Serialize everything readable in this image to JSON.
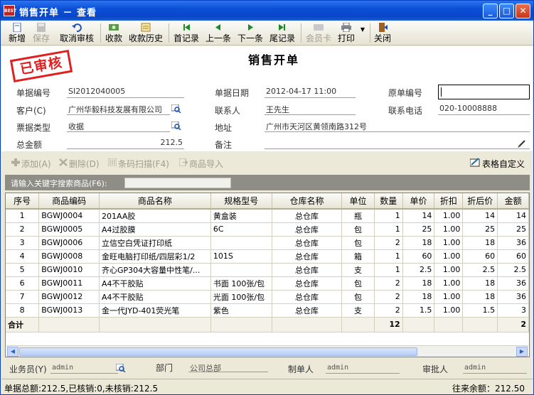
{
  "window": {
    "title": "销售开单 － 查看",
    "logo": "BEST"
  },
  "toolbar": {
    "items": [
      {
        "label": "新增",
        "icon": "new-doc-icon",
        "enabled": true
      },
      {
        "label": "保存",
        "icon": "save-icon",
        "enabled": false
      },
      {
        "label": "取消审核",
        "icon": "undo-icon",
        "enabled": true
      },
      {
        "label": "收款",
        "icon": "money-icon",
        "enabled": true
      },
      {
        "label": "收款历史",
        "icon": "history-icon",
        "enabled": true
      },
      {
        "label": "首记录",
        "icon": "first-record-icon",
        "enabled": true
      },
      {
        "label": "上一条",
        "icon": "prev-record-icon",
        "enabled": true
      },
      {
        "label": "下一条",
        "icon": "next-record-icon",
        "enabled": true
      },
      {
        "label": "尾记录",
        "icon": "last-record-icon",
        "enabled": true
      },
      {
        "label": "会员卡",
        "icon": "member-card-icon",
        "enabled": false
      },
      {
        "label": "打印",
        "icon": "print-icon",
        "enabled": true
      },
      {
        "label": "关闭",
        "icon": "close-door-icon",
        "enabled": true
      }
    ]
  },
  "form": {
    "stamp": "已审核",
    "title": "销售开单",
    "doc_no_label": "单据编号",
    "doc_no": "SI2012040005",
    "doc_date_label": "单据日期",
    "doc_date": "2012-04-17 11:00",
    "orig_no_label": "原单编号",
    "orig_no": "",
    "customer_label": "客户(C)",
    "customer": "广州华毅科技发展有限公司",
    "contact_label": "联系人",
    "contact": "王先生",
    "phone_label": "联系电话",
    "phone": "020-10008888",
    "type_label": "票据类型",
    "type": "收据",
    "address_label": "地址",
    "address": "广州市天河区黄领南路312号",
    "total_label": "总金额",
    "total": "212.5",
    "remark_label": "备注",
    "remark": ""
  },
  "actions": {
    "add": "添加(A)",
    "delete": "删除(D)",
    "scan": "条码扫描(F4)",
    "import": "商品导入",
    "custom": "表格自定义"
  },
  "search": {
    "label": "请输入关键字搜索商品(F6):",
    "value": ""
  },
  "table": {
    "headers": [
      "序号",
      "商品编码",
      "商品名称",
      "规格型号",
      "仓库名称",
      "单位",
      "数量",
      "单价",
      "折扣",
      "折后价",
      "金额"
    ],
    "rows": [
      [
        "1",
        "BGWJ0004",
        "201AA胶",
        "黄盒装",
        "总仓库",
        "瓶",
        "1",
        "14",
        "1.00",
        "14",
        "14"
      ],
      [
        "2",
        "BGWJ0005",
        "A4过胶膜",
        "6C",
        "总仓库",
        "包",
        "1",
        "25",
        "1.00",
        "25",
        "25"
      ],
      [
        "3",
        "BGWJ0006",
        "立信空白凭证打印纸",
        "",
        "总仓库",
        "包",
        "2",
        "18",
        "1.00",
        "18",
        "36"
      ],
      [
        "4",
        "BGWJ0008",
        "金旺电脑打印纸/四层彩1/2",
        "101S",
        "总仓库",
        "箱",
        "1",
        "60",
        "1.00",
        "60",
        "60"
      ],
      [
        "5",
        "BGWJ0010",
        "齐心GP304大容量中性笔/...",
        "",
        "总仓库",
        "支",
        "1",
        "2.5",
        "1.00",
        "2.5",
        "2.5"
      ],
      [
        "6",
        "BGWJ0011",
        "A4不干胶贴",
        "书面 100张/包",
        "总仓库",
        "包",
        "2",
        "18",
        "1.00",
        "18",
        "36"
      ],
      [
        "7",
        "BGWJ0012",
        "A4不干胶贴",
        "光面 100张/包",
        "总仓库",
        "包",
        "2",
        "18",
        "1.00",
        "18",
        "36"
      ],
      [
        "8",
        "BGWJ0013",
        "金一代JYD-401荧光笔",
        "紫色",
        "总仓库",
        "支",
        "2",
        "1.5",
        "1.00",
        "1.5",
        "3"
      ]
    ],
    "sum_label": "合计",
    "sum_qty": "12",
    "sum_amount": "2"
  },
  "footer": {
    "salesman_label": "业务员(Y)",
    "salesman": "admin",
    "dept_label": "部门",
    "dept": "公司总部",
    "maker_label": "制单人",
    "maker": "admin",
    "approver_label": "审批人",
    "approver": "admin"
  },
  "status": {
    "left": "单据总额:212.5,已核销:0,未核销:212.5",
    "right": "往来余额：212.50"
  },
  "colors": {
    "title_bar": "#0a46c8",
    "stamp": "#e02020",
    "window_bg": "#ece9d8"
  }
}
